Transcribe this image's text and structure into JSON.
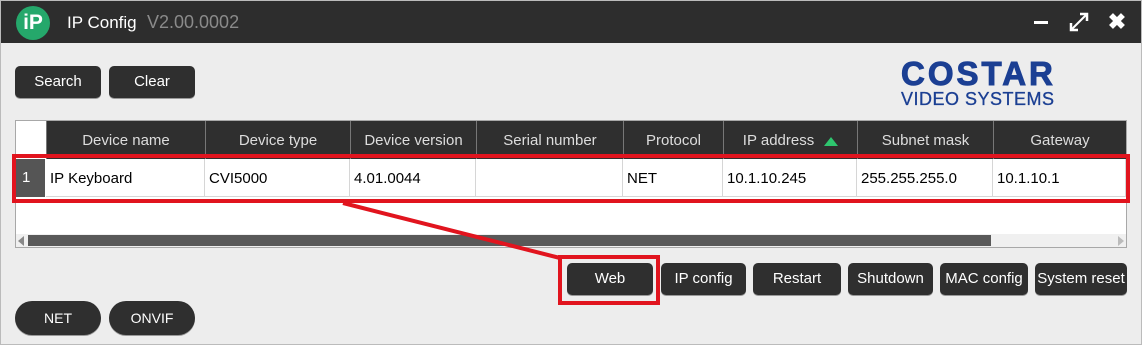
{
  "window": {
    "logo_text": "iP",
    "title": "IP Config",
    "version": "V2.00.0002",
    "close_glyph": "✖"
  },
  "toolbar": {
    "search_label": "Search",
    "clear_label": "Clear"
  },
  "brand": {
    "name": "COSTAR",
    "subtitle": "VIDEO SYSTEMS",
    "color": "#1b3f93"
  },
  "table": {
    "columns": [
      "Device name",
      "Device type",
      "Device version",
      "Serial number",
      "Protocol",
      "IP address",
      "Subnet mask",
      "Gateway"
    ],
    "sorted_column": "IP address",
    "sort_direction": "ascending",
    "rows": [
      {
        "index": "1",
        "device_name": "IP Keyboard",
        "device_type": "CVI5000",
        "device_version": "4.01.0044",
        "serial_number": "",
        "protocol": "NET",
        "ip_address": "10.1.10.245",
        "subnet_mask": "255.255.255.0",
        "gateway": "10.1.10.1"
      }
    ]
  },
  "actions": {
    "web": "Web",
    "ip_config": "IP config",
    "restart": "Restart",
    "shutdown": "Shutdown",
    "mac_config": "MAC config",
    "system_reset": "System reset"
  },
  "mode_buttons": {
    "net": "NET",
    "onvif": "ONVIF"
  },
  "annotation_color": "#e1141e",
  "sort_indicator_color": "#2ec56e"
}
